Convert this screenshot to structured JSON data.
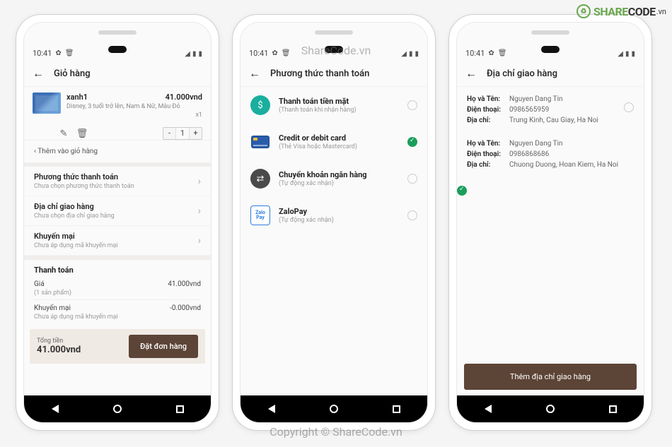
{
  "watermarks": {
    "brand_share": "SHARE",
    "brand_code": "CODE",
    "brand_vn": ".vn",
    "mid": "ShareCode.vn",
    "bottom": "Copyright © ShareCode.vn"
  },
  "status": {
    "time": "10:41"
  },
  "screen1": {
    "header": "Giỏ hàng",
    "item": {
      "name": "xanh1",
      "price": "41.000vnd",
      "desc": "Disney, 3 tuổi trở lên, Nam & Nữ, Màu Đỏ",
      "qty_label": "x1",
      "qty_value": "1"
    },
    "add_more": "‹  Thêm vào giỏ hàng",
    "options": [
      {
        "title": "Phương thức thanh toán",
        "sub": "Chưa chọn phương thức thanh toán"
      },
      {
        "title": "Địa chỉ giao hàng",
        "sub": "Chưa chọn địa chỉ giao hàng"
      },
      {
        "title": "Khuyến mại",
        "sub": "Chưa áp dụng mã khuyến mại"
      }
    ],
    "summary": {
      "head": "Thanh toán",
      "price_label": "Giá",
      "price_value": "41.000vnd",
      "price_sub": "(1 sản phẩm)",
      "promo_label": "Khuyến mại",
      "promo_value": "-0.000vnd",
      "promo_sub": "Chưa áp dụng mã khuyến mại"
    },
    "total": {
      "label": "Tổng tiền",
      "amount": "41.000vnd",
      "button": "Đặt đơn hàng"
    }
  },
  "screen2": {
    "header": "Phương thức thanh toán",
    "methods": [
      {
        "title": "Thanh toán tiền mặt",
        "sub": "(Thanh toán khi nhận hàng)",
        "checked": false,
        "icon": "cash"
      },
      {
        "title": "Credit or debit card",
        "sub": "(Thẻ Visa hoặc Mastercard)",
        "checked": true,
        "icon": "card"
      },
      {
        "title": "Chuyển khoản ngân hàng",
        "sub": "(Tự động xác nhận)",
        "checked": false,
        "icon": "bank"
      },
      {
        "title": "ZaloPay",
        "sub": "(Tự động xác nhận)",
        "checked": false,
        "icon": "zalo"
      }
    ]
  },
  "screen3": {
    "header": "Địa chỉ giao hàng",
    "labels": {
      "name": "Họ và Tên:",
      "phone": "Điện thoại:",
      "addr": "Địa chỉ:"
    },
    "addresses": [
      {
        "name": "Nguyen Dang Tin",
        "phone": "0986565959",
        "addr": "Trung Kinh, Cau Giay, Ha Noi",
        "checked": false
      },
      {
        "name": "Nguyen Dang Tin",
        "phone": "0986868686",
        "addr": "Chuong Duong, Hoan Kiem, Ha Noi",
        "checked": true
      }
    ],
    "add_button": "Thêm địa chỉ giao hàng"
  }
}
